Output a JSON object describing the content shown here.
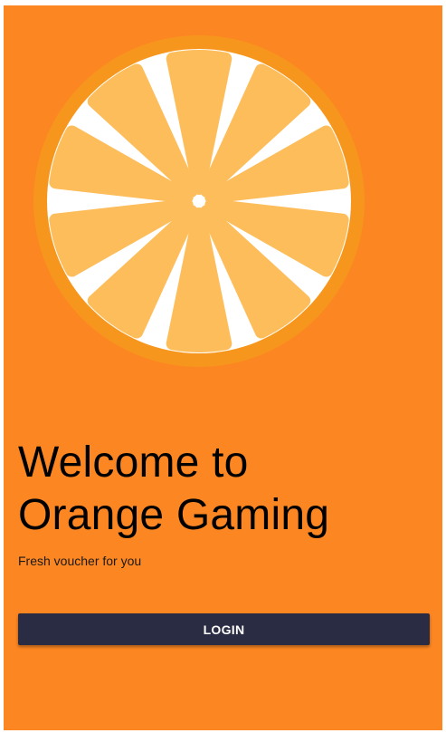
{
  "colors": {
    "background": "#fc8621",
    "rind": "#f7961d",
    "pith": "#ffffff",
    "segment": "#fdbd5a",
    "button": "#2a2c43",
    "button_text": "#ffffff"
  },
  "hero": {
    "icon": "orange-slice-icon"
  },
  "welcome": {
    "title_line1": "Welcome to",
    "title_line2": "Orange Gaming",
    "subtitle": "Fresh voucher for you"
  },
  "actions": {
    "login_label": "LOGIN"
  }
}
